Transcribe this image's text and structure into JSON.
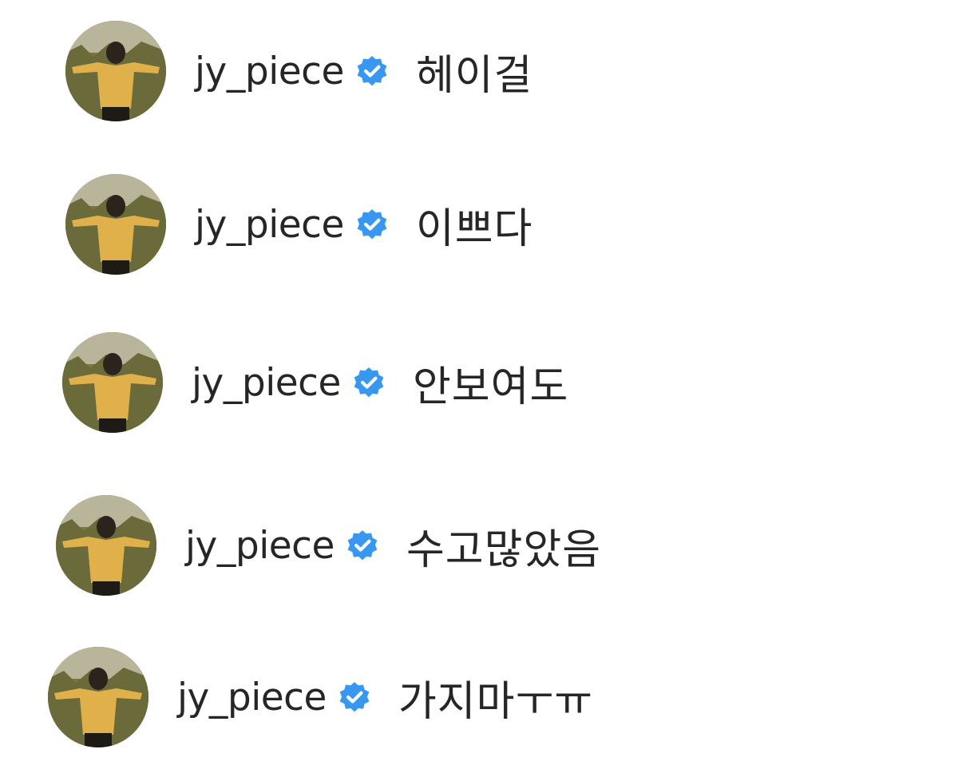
{
  "comments": [
    {
      "username": "jy_piece",
      "verified_icon": "verified-check-icon",
      "text": "헤이걸"
    },
    {
      "username": "jy_piece",
      "verified_icon": "verified-check-icon",
      "text": "이쁘다"
    },
    {
      "username": "jy_piece",
      "verified_icon": "verified-check-icon",
      "text": "안보여도"
    },
    {
      "username": "jy_piece",
      "verified_icon": "verified-check-icon",
      "text": "수고많았음"
    },
    {
      "username": "jy_piece",
      "verified_icon": "verified-check-icon",
      "text": "가지마ㅜㅠ"
    }
  ],
  "colors": {
    "text": "#262626",
    "verified_badge": "#3897f0",
    "background": "#ffffff"
  }
}
